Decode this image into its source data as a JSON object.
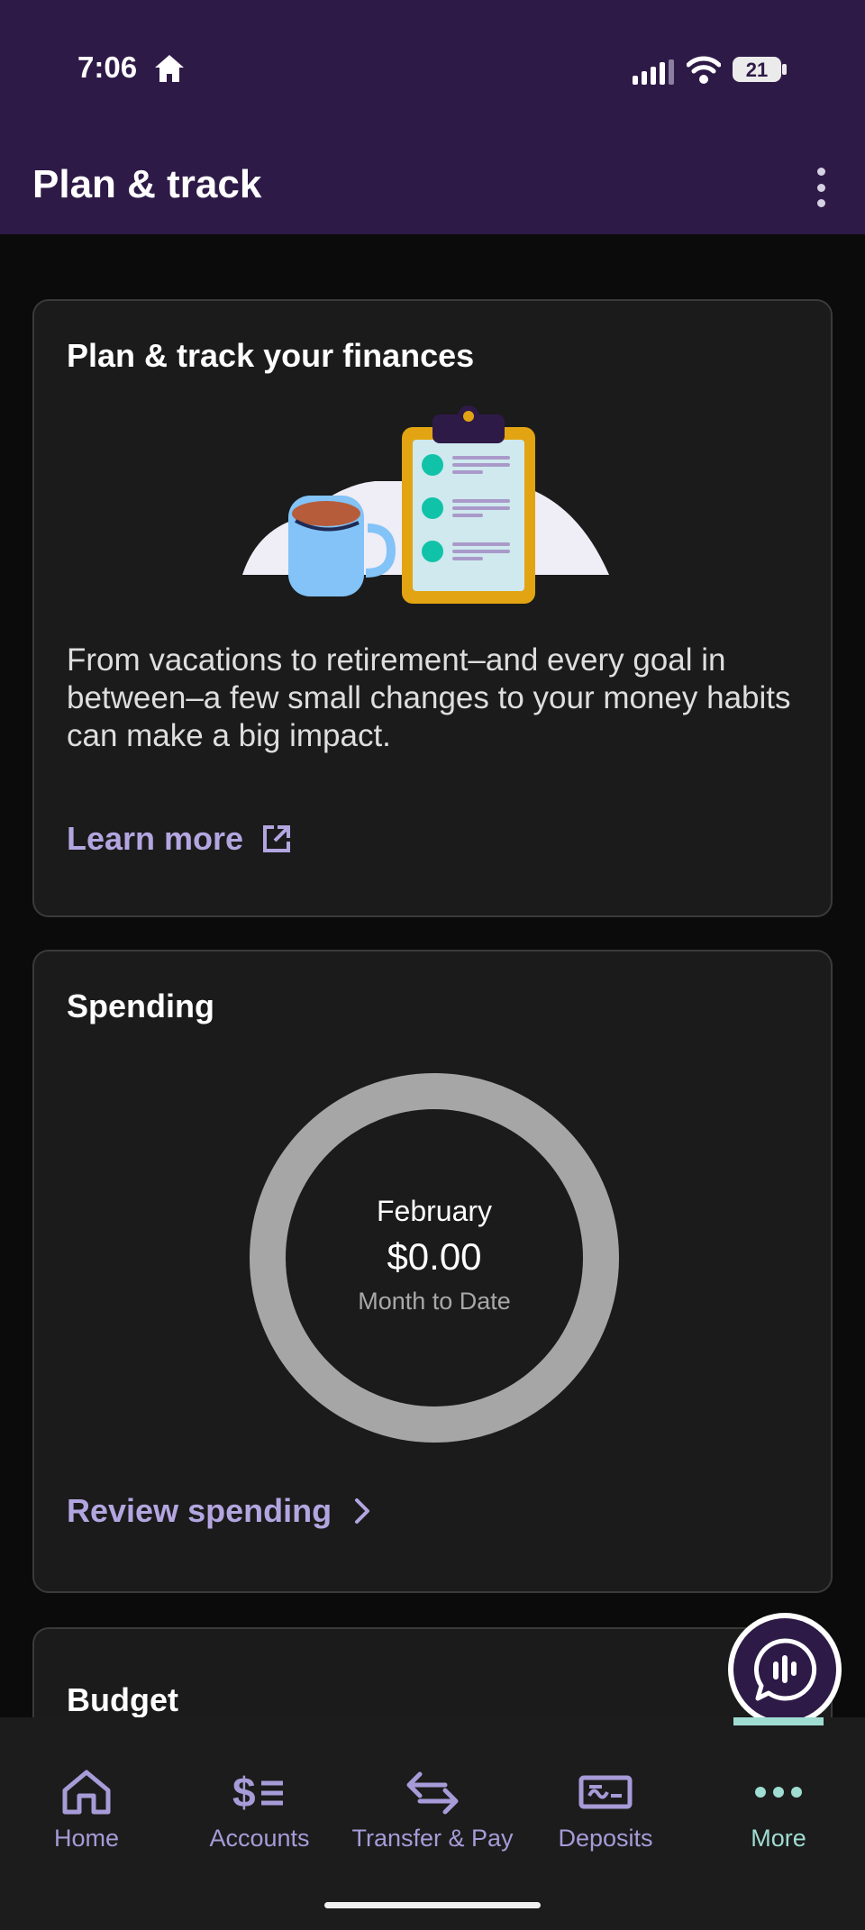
{
  "status_bar": {
    "time": "7:06",
    "battery": "21"
  },
  "header": {
    "title": "Plan & track"
  },
  "plan_card": {
    "title": "Plan & track your finances",
    "body": "From vacations to retirement–and every goal in between–a few small changes to your money habits can make a big impact.",
    "link_label": "Learn more"
  },
  "spending_card": {
    "title": "Spending",
    "month": "February",
    "amount": "$0.00",
    "subtitle": "Month to Date",
    "link_label": "Review spending"
  },
  "budget_card": {
    "title": "Budget"
  },
  "bottom_nav": {
    "items": [
      {
        "label": "Home",
        "icon": "home-icon"
      },
      {
        "label": "Accounts",
        "icon": "accounts-icon"
      },
      {
        "label": "Transfer & Pay",
        "icon": "transfer-icon"
      },
      {
        "label": "Deposits",
        "icon": "deposit-check-icon"
      },
      {
        "label": "More",
        "icon": "more-icon"
      }
    ],
    "active": "More"
  },
  "colors": {
    "header_bg": "#2e1a47",
    "link": "#b3a6e0",
    "active_nav": "#9fdcd2",
    "donut_ring": "#a6a6a6",
    "card_bg": "#1b1b1b"
  }
}
